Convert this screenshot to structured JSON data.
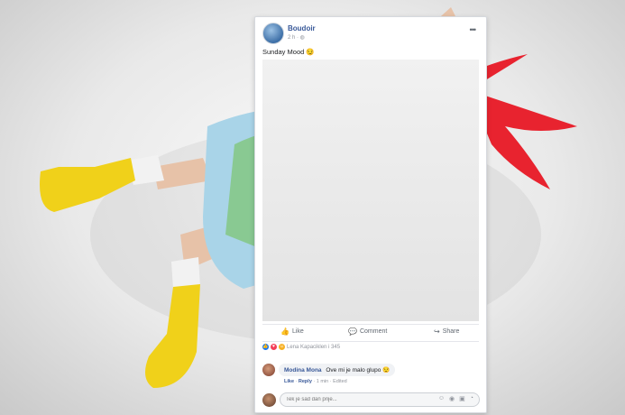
{
  "post": {
    "page_name": "Boudoir",
    "time": "2 h",
    "privacy_icon": "globe-icon",
    "caption": "Sunday Mood 😏"
  },
  "actions": {
    "like_label": "Like",
    "comment_label": "Comment",
    "share_label": "Share"
  },
  "reactions": {
    "names": "Lena Kapaciklen i 345"
  },
  "comment": {
    "author": "Modina Mona",
    "text": "Ove mi je malo glupo 😒",
    "like_link": "Like",
    "reply_link": "Reply",
    "time": "1 min",
    "edited": "Edited"
  },
  "write_comment": {
    "placeholder": "Tek je sad dan prije..."
  },
  "colors": {
    "accent": "#385898",
    "hair": "#e8232f",
    "boots": "#f0d11a",
    "paint": "#7dc52e"
  }
}
